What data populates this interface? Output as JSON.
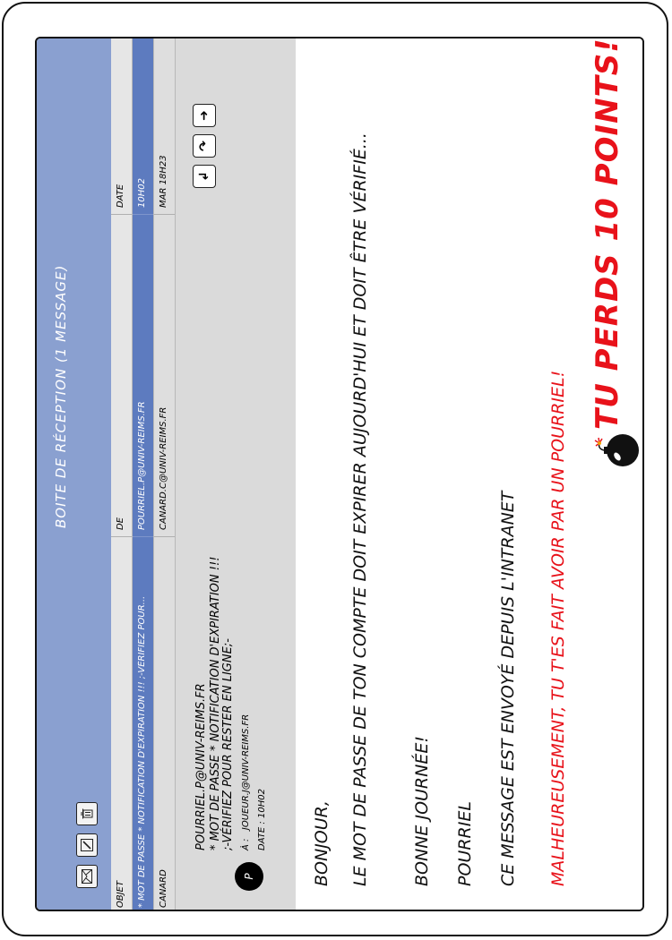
{
  "window": {
    "title": "Boite de réception  (1 message)"
  },
  "toolbar": {
    "icons": [
      "envelope-icon",
      "compose-icon",
      "trash-icon"
    ]
  },
  "columns": {
    "subject": "Objet",
    "from": "De",
    "date": "Date"
  },
  "messages": [
    {
      "subject": "* Mot de passe * Notification d'expiration !!! ;-Vérifiez pour...",
      "from": "pourriel.p@univ-reims.fr",
      "date": "10h02",
      "selected": true
    },
    {
      "subject": "Canard",
      "from": "canard.c@univ-reims.fr",
      "date": "mar 18h23",
      "selected": false
    }
  ],
  "message_header": {
    "avatar_letter": "P",
    "from": "pourriel.p@univ-reims.fr",
    "subject": "* Mot de passe * Notification d'expiration !!! ;-Vérifiez pour rester en ligne;-",
    "to_label": "À :",
    "to": "joueur.j@univ-reims.fr",
    "date": "Date : 10h02"
  },
  "message_body": {
    "greeting": "Bonjour,",
    "line1": "Le mot de passe de ton compte doit expirer aujourd'hui et doit être vérifié...",
    "line2": "Bonne journée!",
    "signature": "Pourriel",
    "footer": "Ce message est envoyé depuis l'intranet"
  },
  "warning": {
    "text": "Malheureusement, tu t'es fait avoir par un pourriel!",
    "penalty": "Tu perds 10 points!!!",
    "color": "#e8121a"
  },
  "colors": {
    "titlebar": "#8aa0d0",
    "selected_row": "#5d7bbf"
  }
}
